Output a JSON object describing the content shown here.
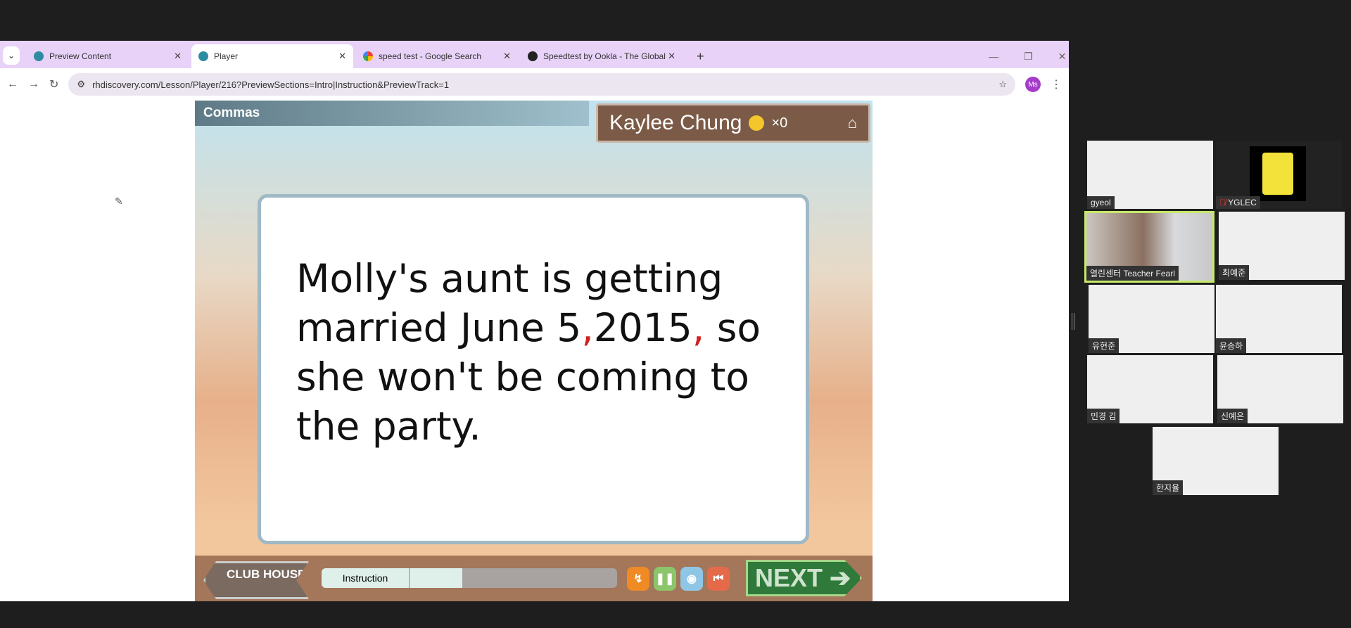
{
  "browser": {
    "tabs": [
      {
        "label": "Preview Content",
        "active": false
      },
      {
        "label": "Player",
        "active": true
      },
      {
        "label": "speed test - Google Search",
        "active": false
      },
      {
        "label": "Speedtest by Ookla - The Global",
        "active": false
      }
    ],
    "new_tab": "+",
    "url": "rhdiscovery.com/Lesson/Player/216?PreviewSections=Intro|Instruction&PreviewTrack=1",
    "profile": "Ms"
  },
  "game": {
    "title": "Commas",
    "player_name": "Kaylee Chung",
    "coins": "×0",
    "sentence_parts": [
      "Molly's aunt is getting married June 5",
      ",",
      "2015",
      ",",
      " so she won't be coming to the party."
    ],
    "club_house": "CLUB HOUSE",
    "progress_label": "Instruction",
    "progress_fraction": 0.2,
    "next_label": "NEXT",
    "accent": "#2f7a3a"
  },
  "participants": [
    {
      "name": "gyeol"
    },
    {
      "name": "YGLEC",
      "muted": true
    },
    {
      "name": "열린센터 Teacher Fearl",
      "active_speaker": true
    },
    {
      "name": "최예준"
    },
    {
      "name": "유현준"
    },
    {
      "name": "윤송하"
    },
    {
      "name": "민경 김"
    },
    {
      "name": "신예은"
    },
    {
      "name": "한지율"
    }
  ]
}
